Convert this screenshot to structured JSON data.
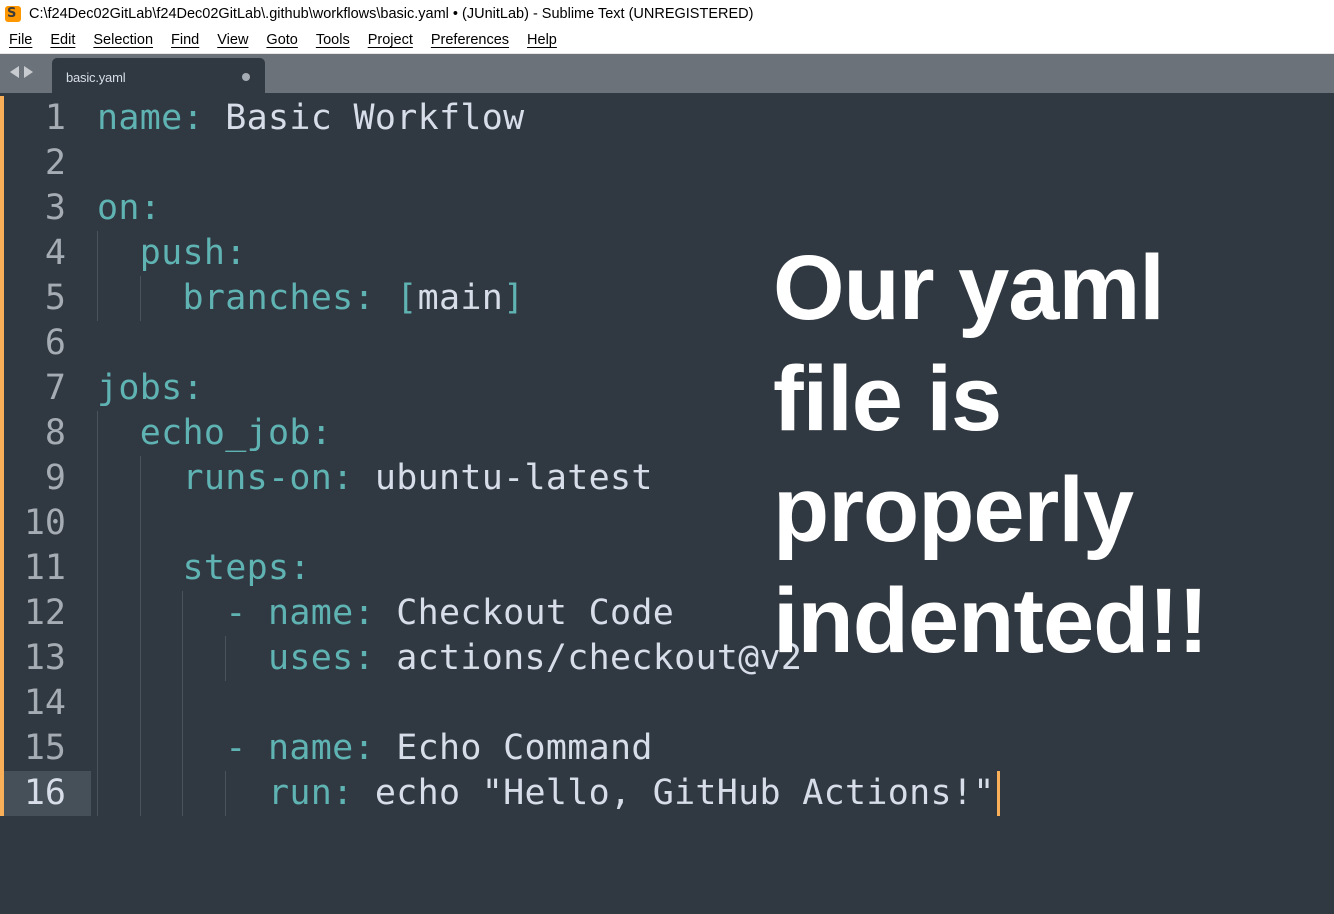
{
  "window": {
    "title": "C:\\f24Dec02GitLab\\f24Dec02GitLab\\.github\\workflows\\basic.yaml • (JUnitLab) - Sublime Text (UNREGISTERED)",
    "app_icon": "sublime-text-icon"
  },
  "menu": [
    "File",
    "Edit",
    "Selection",
    "Find",
    "View",
    "Goto",
    "Tools",
    "Project",
    "Preferences",
    "Help"
  ],
  "tabs": [
    {
      "label": "basic.yaml",
      "dirty": true,
      "active": true
    }
  ],
  "editor": {
    "active_line": 16,
    "lines": [
      {
        "n": "1",
        "tokens": [
          {
            "t": "name",
            "c": "k"
          },
          {
            "t": ": ",
            "c": "p"
          },
          {
            "t": "Basic Workflow",
            "c": "s"
          }
        ]
      },
      {
        "n": "2",
        "tokens": []
      },
      {
        "n": "3",
        "tokens": [
          {
            "t": "on",
            "c": "k"
          },
          {
            "t": ":",
            "c": "p"
          }
        ]
      },
      {
        "n": "4",
        "tokens": [
          {
            "t": "  ",
            "c": "s"
          },
          {
            "t": "push",
            "c": "k"
          },
          {
            "t": ":",
            "c": "p"
          }
        ]
      },
      {
        "n": "5",
        "tokens": [
          {
            "t": "    ",
            "c": "s"
          },
          {
            "t": "branches",
            "c": "k"
          },
          {
            "t": ": ",
            "c": "p"
          },
          {
            "t": "[",
            "c": "p"
          },
          {
            "t": "main",
            "c": "s"
          },
          {
            "t": "]",
            "c": "p"
          }
        ]
      },
      {
        "n": "6",
        "tokens": []
      },
      {
        "n": "7",
        "tokens": [
          {
            "t": "jobs",
            "c": "k"
          },
          {
            "t": ":",
            "c": "p"
          }
        ]
      },
      {
        "n": "8",
        "tokens": [
          {
            "t": "  ",
            "c": "s"
          },
          {
            "t": "echo_job",
            "c": "k"
          },
          {
            "t": ":",
            "c": "p"
          }
        ]
      },
      {
        "n": "9",
        "tokens": [
          {
            "t": "    ",
            "c": "s"
          },
          {
            "t": "runs-on",
            "c": "k"
          },
          {
            "t": ": ",
            "c": "p"
          },
          {
            "t": "ubuntu-latest",
            "c": "s"
          }
        ]
      },
      {
        "n": "10",
        "tokens": []
      },
      {
        "n": "11",
        "tokens": [
          {
            "t": "    ",
            "c": "s"
          },
          {
            "t": "steps",
            "c": "k"
          },
          {
            "t": ":",
            "c": "p"
          }
        ]
      },
      {
        "n": "12",
        "tokens": [
          {
            "t": "      ",
            "c": "s"
          },
          {
            "t": "- ",
            "c": "p"
          },
          {
            "t": "name",
            "c": "k"
          },
          {
            "t": ": ",
            "c": "p"
          },
          {
            "t": "Checkout Code",
            "c": "s"
          }
        ]
      },
      {
        "n": "13",
        "tokens": [
          {
            "t": "        ",
            "c": "s"
          },
          {
            "t": "uses",
            "c": "k"
          },
          {
            "t": ": ",
            "c": "p"
          },
          {
            "t": "actions/checkout@v2",
            "c": "s"
          }
        ]
      },
      {
        "n": "14",
        "tokens": []
      },
      {
        "n": "15",
        "tokens": [
          {
            "t": "      ",
            "c": "s"
          },
          {
            "t": "- ",
            "c": "p"
          },
          {
            "t": "name",
            "c": "k"
          },
          {
            "t": ": ",
            "c": "p"
          },
          {
            "t": "Echo Command",
            "c": "s"
          }
        ]
      },
      {
        "n": "16",
        "tokens": [
          {
            "t": "        ",
            "c": "s"
          },
          {
            "t": "run",
            "c": "k"
          },
          {
            "t": ": ",
            "c": "p"
          },
          {
            "t": "echo \"Hello, GitHub Actions!\"",
            "c": "s"
          }
        ]
      }
    ]
  },
  "overlay_text": [
    "Our yaml",
    "file is",
    "properly",
    "indented!!"
  ],
  "colors": {
    "background": "#303841",
    "key": "#5fb3b3",
    "string": "#d8dee9",
    "line_number": "#a6acb3",
    "modified_marker": "#f9ae58",
    "tabbar": "#6b727a"
  }
}
